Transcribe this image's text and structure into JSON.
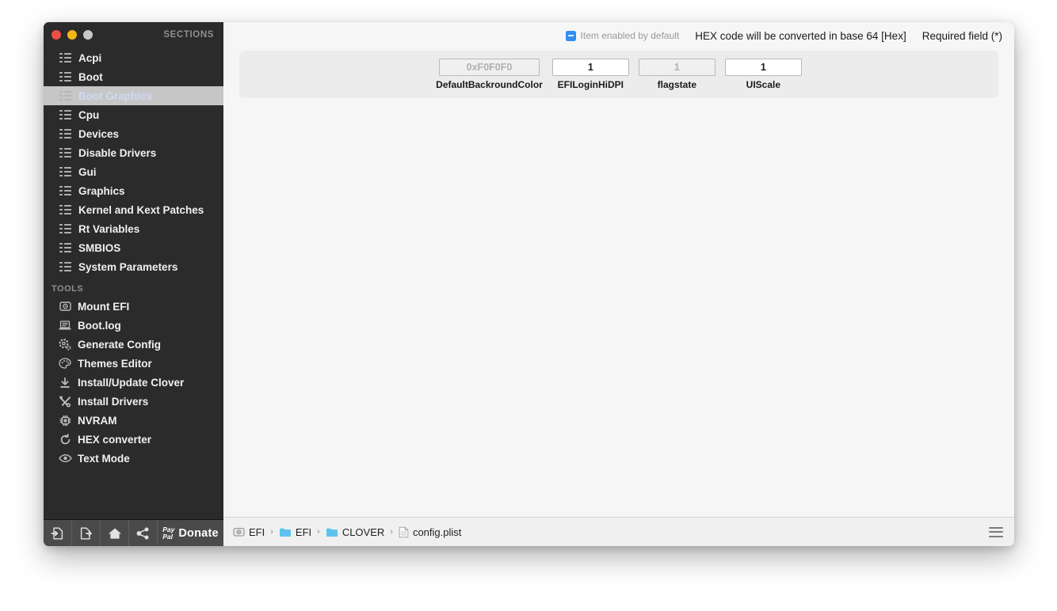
{
  "window": {
    "traffic_lights": [
      "close",
      "minimize",
      "zoom"
    ],
    "sidebar_header": "SECTIONS"
  },
  "sidebar": {
    "sections": [
      {
        "label": "Acpi",
        "icon": "list-icon",
        "selected": false
      },
      {
        "label": "Boot",
        "icon": "list-icon",
        "selected": false
      },
      {
        "label": "Boot Graphics",
        "icon": "list-icon",
        "selected": true
      },
      {
        "label": "Cpu",
        "icon": "list-icon",
        "selected": false
      },
      {
        "label": "Devices",
        "icon": "list-icon",
        "selected": false
      },
      {
        "label": "Disable Drivers",
        "icon": "list-icon",
        "selected": false
      },
      {
        "label": "Gui",
        "icon": "list-icon",
        "selected": false
      },
      {
        "label": "Graphics",
        "icon": "list-icon",
        "selected": false
      },
      {
        "label": "Kernel and Kext Patches",
        "icon": "list-icon",
        "selected": false
      },
      {
        "label": "Rt Variables",
        "icon": "list-icon",
        "selected": false
      },
      {
        "label": "SMBIOS",
        "icon": "list-icon",
        "selected": false
      },
      {
        "label": "System Parameters",
        "icon": "list-icon",
        "selected": false
      }
    ],
    "tools_header": "TOOLS",
    "tools": [
      {
        "label": "Mount EFI",
        "icon": "disk-icon"
      },
      {
        "label": "Boot.log",
        "icon": "laptop-icon"
      },
      {
        "label": "Generate Config",
        "icon": "gear-icon"
      },
      {
        "label": "Themes Editor",
        "icon": "palette-icon"
      },
      {
        "label": "Install/Update Clover",
        "icon": "download-icon"
      },
      {
        "label": "Install Drivers",
        "icon": "tools-icon"
      },
      {
        "label": "NVRAM",
        "icon": "chip-icon"
      },
      {
        "label": "HEX converter",
        "icon": "refresh-icon"
      },
      {
        "label": "Text Mode",
        "icon": "eye-icon"
      }
    ],
    "toolbar": {
      "buttons": [
        {
          "name": "import-button",
          "icon": "import-icon"
        },
        {
          "name": "export-button",
          "icon": "export-icon"
        },
        {
          "name": "home-button",
          "icon": "home-icon"
        },
        {
          "name": "share-button",
          "icon": "share-icon"
        }
      ],
      "paypal_line1": "Pay",
      "paypal_line2": "Pal",
      "donate_label": "Donate"
    }
  },
  "legend": {
    "checkbox_note": "Item enabled by default",
    "hex_note": "HEX code will be converted in base 64 [Hex]",
    "required_note": "Required field (*)"
  },
  "fields": [
    {
      "name": "default-backround-color",
      "label": "DefaultBackroundColor",
      "value": "0xF0F0F0",
      "dim": true,
      "width": "w-hex"
    },
    {
      "name": "efi-login-hidpi",
      "label": "EFILoginHiDPI",
      "value": "1",
      "dim": false,
      "width": "w-dpi"
    },
    {
      "name": "flagstate",
      "label": "flagstate",
      "value": "1",
      "dim": true,
      "width": "w-flag"
    },
    {
      "name": "ui-scale",
      "label": "UIScale",
      "value": "1",
      "dim": false,
      "width": "w-scale"
    }
  ],
  "statusbar": {
    "breadcrumb": [
      {
        "label": "EFI",
        "icon": "disk-icon"
      },
      {
        "label": "EFI",
        "icon": "folder-icon"
      },
      {
        "label": "CLOVER",
        "icon": "folder-icon"
      },
      {
        "label": "config.plist",
        "icon": "document-icon"
      }
    ],
    "separator": "›",
    "menu_icon": "hamburger-icon"
  },
  "colors": {
    "sidebar_bg": "#2b2b2b",
    "selected_row_bg": "#c6c6c6",
    "selected_row_text": "#cfdaf2",
    "accent_blue": "#2f8ef4",
    "folder_blue": "#5ec2ef",
    "content_bg": "#f6f6f6",
    "panel_bg": "#ececec"
  }
}
